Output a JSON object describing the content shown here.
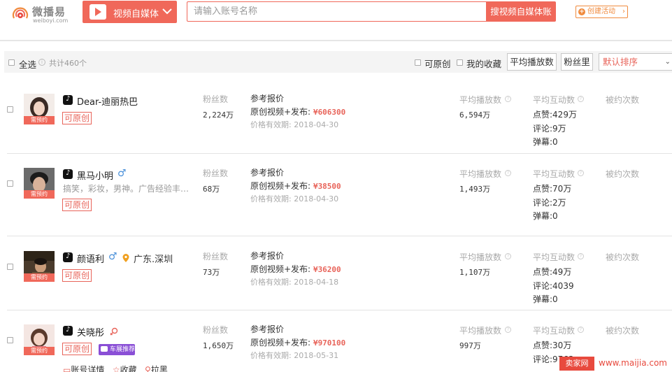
{
  "header": {
    "logo_name": "微播易",
    "logo_url": "weiboyi.com",
    "media_type": "视频自媒体",
    "search_placeholder": "请输入账号名称",
    "search_button": "搜视频自媒体账",
    "create_button": "创建活动"
  },
  "toolbar": {
    "select_all": "全选",
    "total": "共计460个",
    "filter_original": "可原创",
    "filter_favorites": "我的收藏",
    "sort_avg_play": "平均播放数",
    "sort_fans": "粉丝里",
    "sort_default": "默认排序"
  },
  "labels": {
    "badge": "需预约",
    "fans": "粉丝数",
    "quote": "参考报价",
    "avg_play": "平均播放数",
    "avg_interaction": "平均互动数",
    "booked": "被约次数",
    "original_tag": "可原创",
    "likes_prefix": "点赞:",
    "comments_prefix": "评论:",
    "danmu_prefix": "弹幕:",
    "price_prefix": "原创视频+发布:",
    "price_currency": "¥",
    "valid_prefix": "价格有效期:",
    "car_tag": "车展推荐",
    "action_detail": "账号详情",
    "action_fav": "收藏",
    "action_block": "拉黑"
  },
  "rows": [
    {
      "name": "Dear-迪丽热巴",
      "gender": "",
      "location": "",
      "intro": "",
      "fans": "2,224万",
      "price": "606300",
      "valid": "2018-04-30",
      "avg_play": "6,594万",
      "likes": "429万",
      "comments": "9万",
      "danmu": "0"
    },
    {
      "name": "黑马小明",
      "gender": "♂",
      "location": "",
      "intro": "搞笑，彩妆，男神。广告经验丰…",
      "fans": "68万",
      "price": "38500",
      "valid": "2018-04-30",
      "avg_play": "1,493万",
      "likes": "70万",
      "comments": "2万",
      "danmu": "0"
    },
    {
      "name": "颜语利",
      "gender": "♂",
      "location": "广东.深圳",
      "intro": "",
      "fans": "73万",
      "price": "36200",
      "valid": "2018-04-18",
      "avg_play": "1,107万",
      "likes": "49万",
      "comments": "4039",
      "danmu": "0"
    },
    {
      "name": "关晓彤",
      "gender": "",
      "location": "",
      "intro": "",
      "fans": "1,650万",
      "price": "970100",
      "valid": "2018-05-31",
      "avg_play": "997万",
      "likes": "30万",
      "comments": "9763",
      "danmu": ""
    }
  ],
  "watermark": {
    "site": "卖家网",
    "url": "www.maijia.com"
  },
  "colors": {
    "brand": "#f0685a",
    "price": "#e8645a",
    "orange": "#f08a3c",
    "car_tag": "#8a4fd6",
    "gender_male": "#4a90d9"
  }
}
